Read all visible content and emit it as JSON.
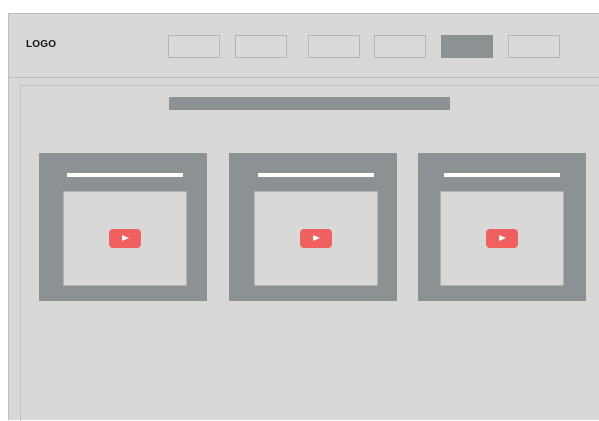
{
  "header": {
    "logo": "LOGO",
    "nav": [
      {
        "id": "nav-item-1",
        "active": false
      },
      {
        "id": "nav-item-2",
        "active": false
      },
      {
        "id": "nav-item-3",
        "active": false
      },
      {
        "id": "nav-item-4",
        "active": false
      },
      {
        "id": "nav-item-5",
        "active": true
      },
      {
        "id": "nav-item-6",
        "active": false
      }
    ]
  },
  "main": {
    "cards": [
      {
        "media": "video",
        "icon": "play-icon"
      },
      {
        "media": "video",
        "icon": "play-icon"
      },
      {
        "media": "video",
        "icon": "play-icon"
      }
    ]
  },
  "colors": {
    "background": "#d8d8d8",
    "placeholder": "#8c9193",
    "accent": "#f0605e",
    "title_line": "#ffffff"
  }
}
